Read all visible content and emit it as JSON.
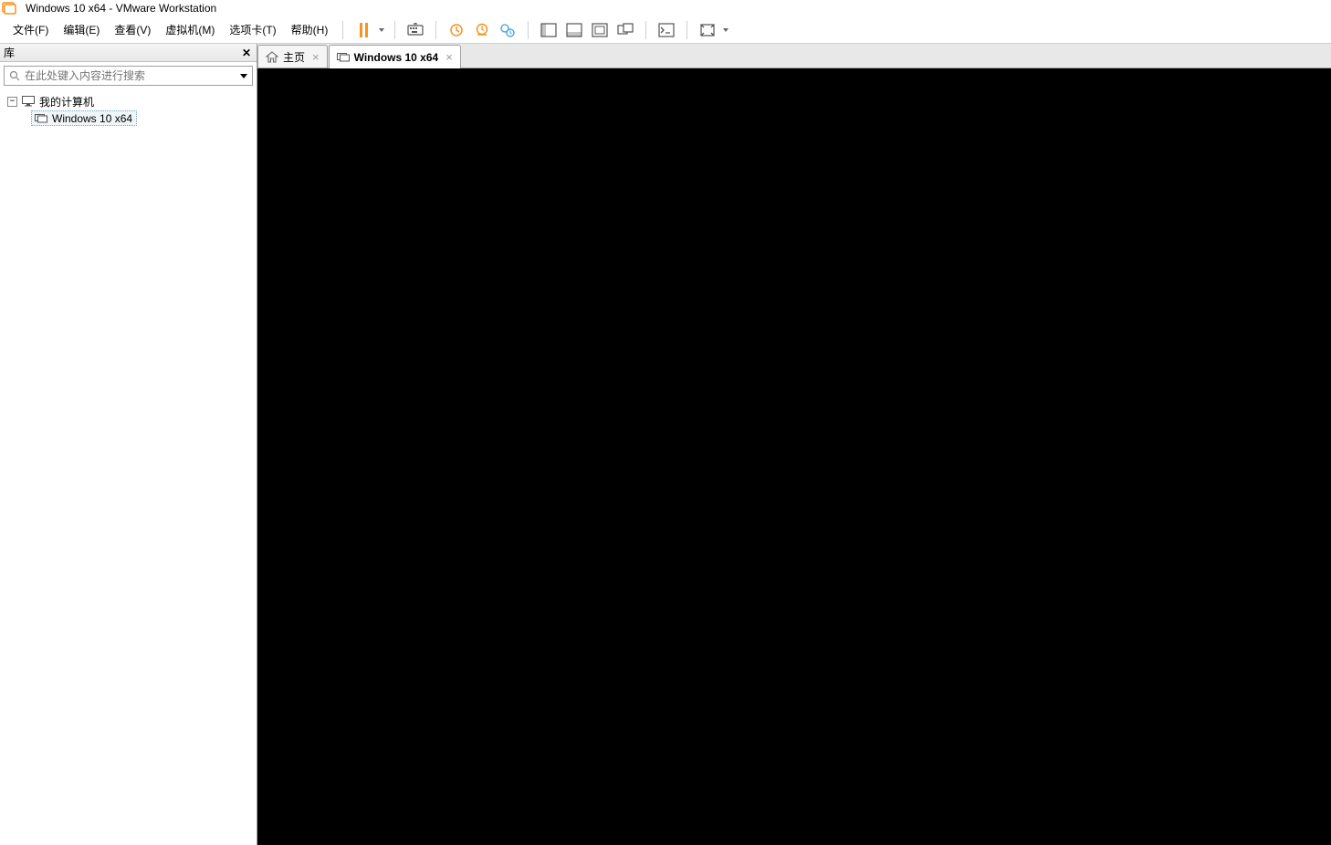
{
  "titlebar": {
    "text": "Windows 10 x64 - VMware Workstation"
  },
  "menubar": {
    "items": [
      "文件(F)",
      "编辑(E)",
      "查看(V)",
      "虚拟机(M)",
      "选项卡(T)",
      "帮助(H)"
    ]
  },
  "toolbar": {
    "pause": "pause",
    "send_ctrl_alt_del": "send-ctrl-alt-del",
    "snapshot": "snapshot",
    "revert": "revert",
    "manage_snapshots": "manage-snapshots",
    "show_sidebar": "show-sidebar",
    "show_console": "show-console",
    "stretch": "stretch",
    "unity": "unity",
    "fullscreen": "fullscreen",
    "cycle": "cycle"
  },
  "sidebar": {
    "title": "库",
    "search_placeholder": "在此处键入内容进行搜索",
    "tree": {
      "root": "我的计算机",
      "children": [
        "Windows 10 x64"
      ]
    }
  },
  "tabs": [
    {
      "label": "主页",
      "closable": true,
      "active": false,
      "icon": "home"
    },
    {
      "label": "Windows 10 x64",
      "closable": true,
      "active": true,
      "icon": "vm"
    }
  ]
}
